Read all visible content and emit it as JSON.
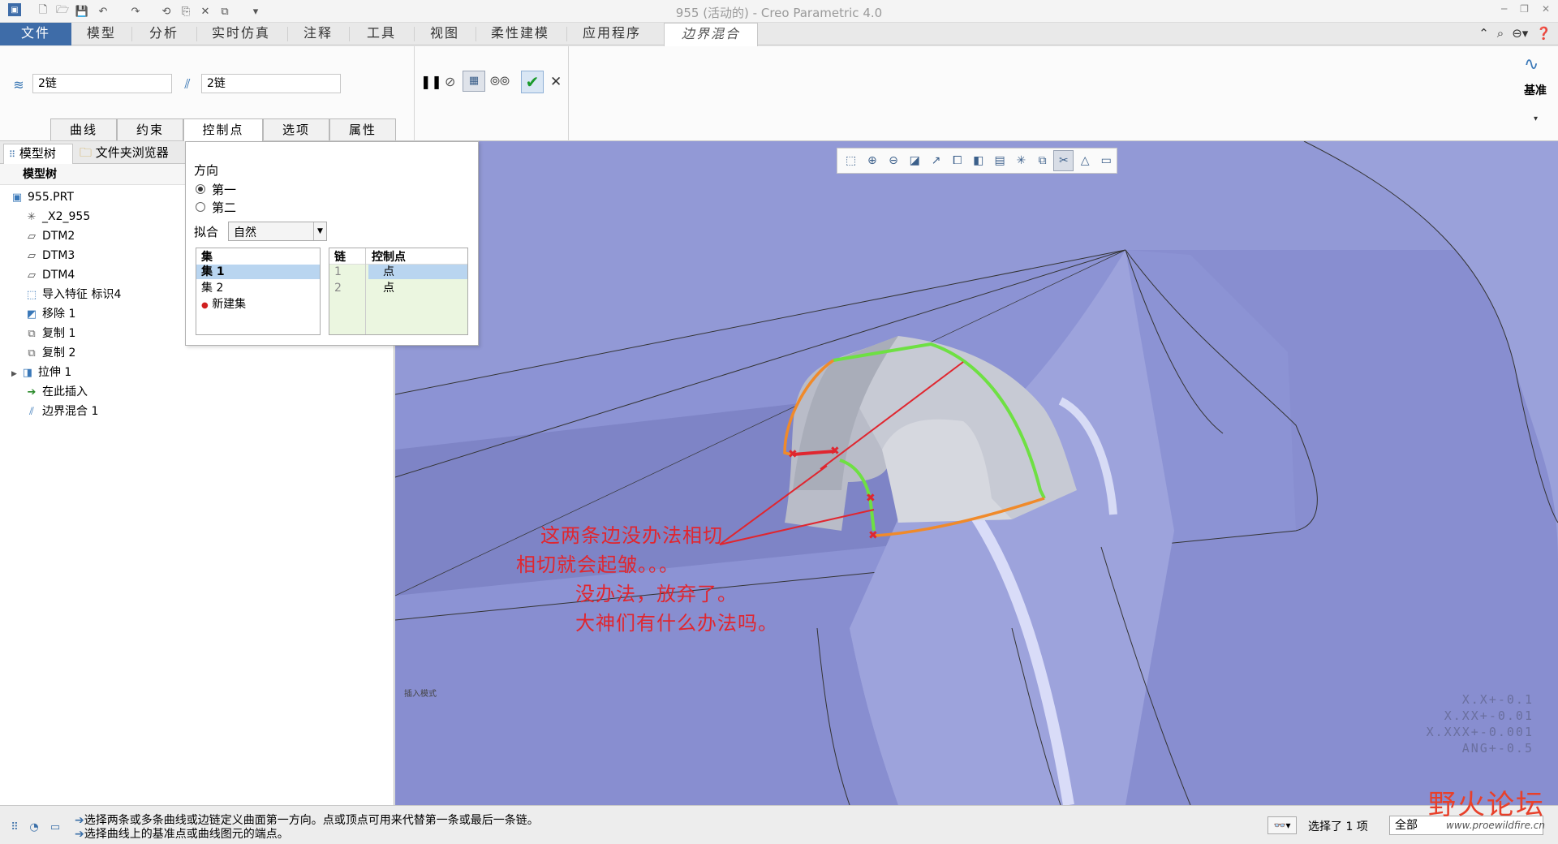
{
  "window": {
    "title": "955 (活动的) - Creo Parametric 4.0"
  },
  "tabs": [
    {
      "label": "文件",
      "left": 0
    },
    {
      "label": "模型"
    },
    {
      "label": "分析"
    },
    {
      "label": "实时仿真"
    },
    {
      "label": "注释"
    },
    {
      "label": "工具"
    },
    {
      "label": "视图"
    },
    {
      "label": "柔性建模"
    },
    {
      "label": "应用程序"
    },
    {
      "label": "边界混合"
    }
  ],
  "dashboard": {
    "first_dir_value": "2链",
    "second_dir_value": "2链",
    "subtabs": [
      "曲线",
      "约束",
      "控制点",
      "选项",
      "属性"
    ],
    "datum_label": "基准"
  },
  "left_panel": {
    "tab_model_tree": "模型树",
    "tab_folder_browser": "文件夹浏览器",
    "tree_header": "模型树",
    "items": [
      "955.PRT",
      "_X2_955",
      "DTM2",
      "DTM3",
      "DTM4",
      "导入特征 标识4",
      "移除 1",
      "复制 1",
      "复制 2",
      "拉伸 1",
      "在此插入",
      "边界混合 1"
    ]
  },
  "control_points": {
    "direction_label": "方向",
    "dir_first": "第一",
    "dir_second": "第二",
    "fit_label": "拟合",
    "fit_value": "自然",
    "sets_header": "集",
    "sets": [
      "集 1",
      "集 2",
      "新建集"
    ],
    "chain_header": "链",
    "cp_header": "控制点",
    "rows": [
      {
        "chain": "1",
        "point": "点"
      },
      {
        "chain": "2",
        "point": "点"
      }
    ]
  },
  "graphics": {
    "annotations": [
      "这两条边没办法相切",
      "相切就会起皱。。。",
      "没办法，放弃了。",
      "大神们有什么办法吗。"
    ],
    "insert_mode": "插入模式",
    "tolerances": [
      "X.X+-0.1",
      "X.XX+-0.01",
      "X.XXX+-0.001",
      "ANG+-0.5"
    ]
  },
  "status": {
    "message_1": "选择两条或多条曲线或边链定义曲面第一方向。点或顶点可用来代替第一条或最后一条链。",
    "message_2": "选择曲线上的基准点或曲线图元的端点。",
    "selected": "选择了 1 项",
    "filter": "全部"
  },
  "watermark": {
    "brand": "野火论坛",
    "url": "www.proewildfire.cn"
  },
  "colors": {
    "accent": "#3e6ca8",
    "viewport": "#9299d6",
    "annotation": "#e0262f",
    "green_edge": "#6ee043",
    "orange_edge": "#f08a2a"
  }
}
